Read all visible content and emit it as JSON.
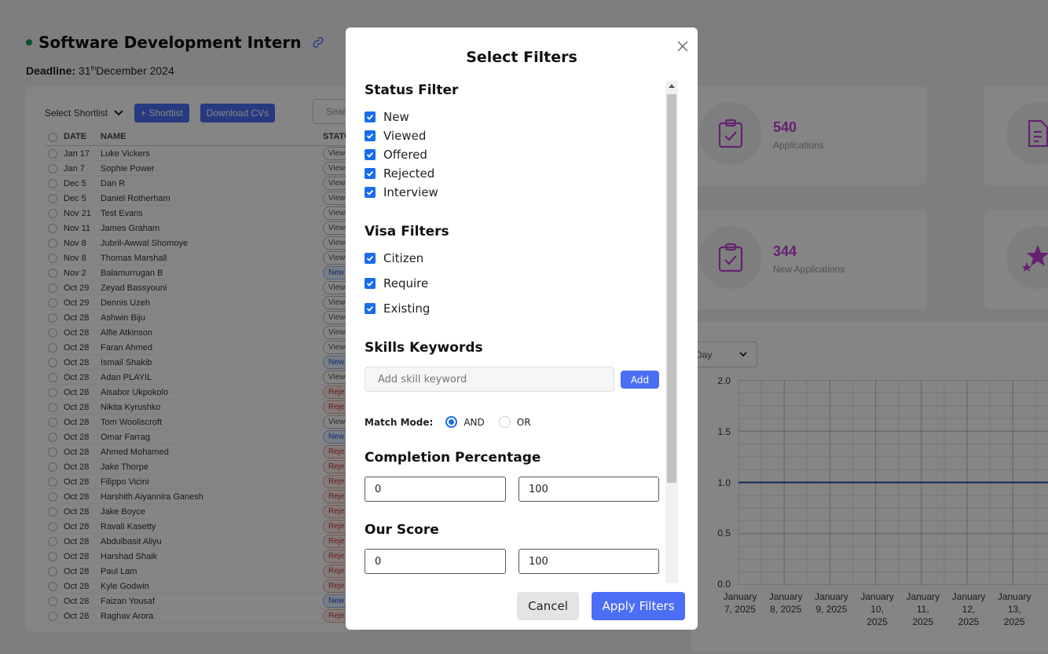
{
  "page": {
    "job_title": "Software Development Intern",
    "deadline_label": "Deadline:",
    "deadline_day": "31",
    "deadline_suffix": "th",
    "deadline_rest": "December 2024"
  },
  "toolbar": {
    "shortlist_select": "Select Shortlist",
    "add_shortlist": "+ Shortlist",
    "download_cvs": "Download CVs",
    "search_placeholder": "Sear"
  },
  "table": {
    "headers": {
      "date": "DATE",
      "name": "NAME",
      "status": "STATU"
    },
    "rows": [
      {
        "date": "Jan 17",
        "name": "Luke Vickers",
        "status": "View",
        "kind": "viewed"
      },
      {
        "date": "Jan 7",
        "name": "Sophie Power",
        "status": "View",
        "kind": "viewed"
      },
      {
        "date": "Dec 5",
        "name": "Dan R",
        "status": "View",
        "kind": "viewed"
      },
      {
        "date": "Dec 5",
        "name": "Daniel Rotherham",
        "status": "View",
        "kind": "viewed"
      },
      {
        "date": "Nov 21",
        "name": "Test Evans",
        "status": "View",
        "kind": "viewed"
      },
      {
        "date": "Nov 11",
        "name": "James Graham",
        "status": "View",
        "kind": "viewed"
      },
      {
        "date": "Nov 8",
        "name": "Jubril-Awwal Shomoye",
        "status": "View",
        "kind": "viewed"
      },
      {
        "date": "Nov 8",
        "name": "Thomas Marshall",
        "status": "View",
        "kind": "viewed"
      },
      {
        "date": "Nov 2",
        "name": "Balamurrugan B",
        "status": "New",
        "kind": "new"
      },
      {
        "date": "Oct 29",
        "name": "Zeyad Bassyouni",
        "status": "View",
        "kind": "viewed"
      },
      {
        "date": "Oct 29",
        "name": "Dennis Uzeh",
        "status": "View",
        "kind": "viewed"
      },
      {
        "date": "Oct 28",
        "name": "Ashwin Biju",
        "status": "View",
        "kind": "viewed"
      },
      {
        "date": "Oct 28",
        "name": "Alfie Atkinson",
        "status": "View",
        "kind": "viewed"
      },
      {
        "date": "Oct 28",
        "name": "Faran Ahmed",
        "status": "View",
        "kind": "viewed"
      },
      {
        "date": "Oct 28",
        "name": "Ismail Shakib",
        "status": "New",
        "kind": "new"
      },
      {
        "date": "Oct 28",
        "name": "Adan PLAYIL",
        "status": "View",
        "kind": "viewed"
      },
      {
        "date": "Oct 28",
        "name": "Aisabor Ukpokolo",
        "status": "Reje",
        "kind": "rejected"
      },
      {
        "date": "Oct 28",
        "name": "Nikita Kyrushko",
        "status": "Reje",
        "kind": "rejected"
      },
      {
        "date": "Oct 28",
        "name": "Tom Wooliscroft",
        "status": "View",
        "kind": "viewed"
      },
      {
        "date": "Oct 28",
        "name": "Omar Farrag",
        "status": "New",
        "kind": "new"
      },
      {
        "date": "Oct 28",
        "name": "Ahmed Mohamed",
        "status": "Reje",
        "kind": "rejected"
      },
      {
        "date": "Oct 28",
        "name": "Jake Thorpe",
        "status": "Reje",
        "kind": "rejected"
      },
      {
        "date": "Oct 28",
        "name": "Filippo Vicini",
        "status": "Reje",
        "kind": "rejected"
      },
      {
        "date": "Oct 28",
        "name": "Harshith Aiyannira Ganesh",
        "status": "Reje",
        "kind": "rejected"
      },
      {
        "date": "Oct 28",
        "name": "Jake Boyce",
        "status": "Reje",
        "kind": "rejected"
      },
      {
        "date": "Oct 28",
        "name": "Ravali Kasetty",
        "status": "Reje",
        "kind": "rejected"
      },
      {
        "date": "Oct 28",
        "name": "Abdulbasit Aliyu",
        "status": "Reje",
        "kind": "rejected"
      },
      {
        "date": "Oct 28",
        "name": "Harshad Shaik",
        "status": "Reje",
        "kind": "rejected"
      },
      {
        "date": "Oct 28",
        "name": "Paul Lam",
        "status": "Reje",
        "kind": "rejected"
      },
      {
        "date": "Oct 28",
        "name": "Kyle Godwin",
        "status": "Reje",
        "kind": "rejected"
      },
      {
        "date": "Oct 28",
        "name": "Faizan Yousaf",
        "status": "New",
        "kind": "new"
      },
      {
        "date": "Oct 28",
        "name": "Raghav Arora",
        "status": "Reje",
        "kind": "rejected"
      }
    ]
  },
  "cards": {
    "applications": {
      "value": "540",
      "label": "Applications"
    },
    "new_applications": {
      "value": "344",
      "label": "New Applications"
    }
  },
  "chart": {
    "range_select": "Day",
    "y_ticks": [
      "2.0",
      "1.5",
      "1.0",
      "0.5",
      "0.0"
    ],
    "x_ticks": [
      [
        "January",
        "7, 2025"
      ],
      [
        "January",
        "8, 2025"
      ],
      [
        "January",
        "9, 2025"
      ],
      [
        "January",
        "10,",
        "2025"
      ],
      [
        "January",
        "11,",
        "2025"
      ],
      [
        "January",
        "12,",
        "2025"
      ],
      [
        "January",
        "13,",
        "2025"
      ]
    ],
    "line_color": "#1f4fa3"
  },
  "chart_data": {
    "type": "line",
    "x": [
      "January 7, 2025",
      "January 8, 2025",
      "January 9, 2025",
      "January 10, 2025",
      "January 11, 2025",
      "January 12, 2025",
      "January 13, 2025"
    ],
    "values": [
      1.0,
      1.0,
      1.0,
      1.0,
      1.0,
      1.0,
      1.0
    ],
    "ylim": [
      0,
      2.0
    ],
    "grid": true
  },
  "modal": {
    "title": "Select Filters",
    "status_filter": {
      "title": "Status Filter",
      "options": [
        "New",
        "Viewed",
        "Offered",
        "Rejected",
        "Interview"
      ]
    },
    "visa_filters": {
      "title": "Visa Filters",
      "options": [
        "Citizen",
        "Require",
        "Existing"
      ]
    },
    "skills": {
      "title": "Skills Keywords",
      "placeholder": "Add skill keyword",
      "add_label": "Add"
    },
    "match_mode": {
      "label": "Match Mode:",
      "options": [
        "AND",
        "OR"
      ],
      "selected": "AND"
    },
    "completion": {
      "title": "Completion Percentage",
      "min": "0",
      "max": "100"
    },
    "our_score": {
      "title": "Our Score",
      "min": "0",
      "max": "100"
    },
    "cancel_label": "Cancel",
    "apply_label": "Apply Filters"
  },
  "colors": {
    "accent": "#4c6ef5",
    "checkbox": "#1a6dea",
    "card_value": "#c041d6"
  }
}
